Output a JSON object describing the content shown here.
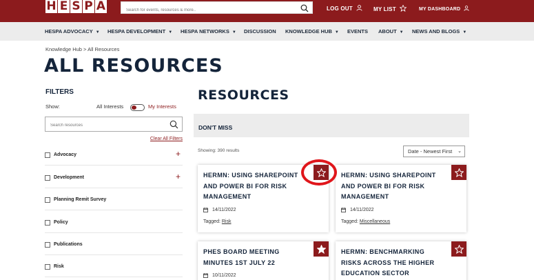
{
  "header": {
    "logo_letters": [
      "H",
      "E",
      "S",
      "P",
      "A"
    ],
    "search_placeholder": "Search for events, resources & more..",
    "logout_label": "LOG OUT",
    "mylist_label": "MY LIST",
    "dashboard_label": "MY DASHBOARD",
    "brand_color": "#8c1b1d"
  },
  "nav": {
    "items": [
      {
        "label": "HESPA ADVOCACY",
        "caret": true
      },
      {
        "label": "HESPA DEVELOPMENT",
        "caret": true
      },
      {
        "label": "HESPA NETWORKS",
        "caret": true
      },
      {
        "label": "DISCUSSION",
        "caret": false
      },
      {
        "label": "KNOWLEDGE HUB",
        "caret": true
      },
      {
        "label": "EVENTS",
        "caret": false
      },
      {
        "label": "ABOUT",
        "caret": true
      },
      {
        "label": "NEWS AND BLOGS",
        "caret": true
      }
    ]
  },
  "breadcrumb": "Knowledge Hub > All Resources",
  "page_title": "ALL RESOURCES",
  "filters": {
    "heading": "FILTERS",
    "show_label": "Show:",
    "option_all": "All Interests",
    "option_mine": "My Interests",
    "search_placeholder": "Search resources",
    "clear_label": "Clear All Filters",
    "items": [
      {
        "label": "Advocacy",
        "expandable": true
      },
      {
        "label": "Development",
        "expandable": true
      },
      {
        "label": "Planning Remit Survey",
        "expandable": false
      },
      {
        "label": "Policy",
        "expandable": false
      },
      {
        "label": "Publications",
        "expandable": false
      },
      {
        "label": "Risk",
        "expandable": false
      }
    ]
  },
  "resources": {
    "heading": "RESOURCES",
    "dont_miss": "DON'T MISS",
    "showing": "Showing: 390 results",
    "sort_value": "Date - Newest First",
    "cards": [
      {
        "title_lines": [
          "HERMN: USING SHAREPOINT",
          "AND POWER BI FOR RISK",
          "MANAGEMENT"
        ],
        "date": "14/11/2022",
        "tag_label": "Tagged:",
        "tag": "Risk",
        "star": "outline"
      },
      {
        "title_lines": [
          "HERMN: USING SHAREPOINT",
          "AND POWER BI FOR RISK",
          "MANAGEMENT"
        ],
        "date": "14/11/2022",
        "tag_label": "Tagged:",
        "tag": "Miscellaneous",
        "star": "outline"
      },
      {
        "title_lines": [
          "PHES BOARD MEETING",
          "MINUTES 1ST JULY 22"
        ],
        "date": "10/11/2022",
        "star": "filled"
      },
      {
        "title_lines": [
          "HERMN: BENCHMARKING",
          "RISKS ACROSS THE HIGHER",
          "EDUCATION SECTOR"
        ],
        "star": "outline"
      }
    ]
  },
  "highlight": {
    "shape": "red-circle-annotation",
    "color": "#e0161b"
  }
}
